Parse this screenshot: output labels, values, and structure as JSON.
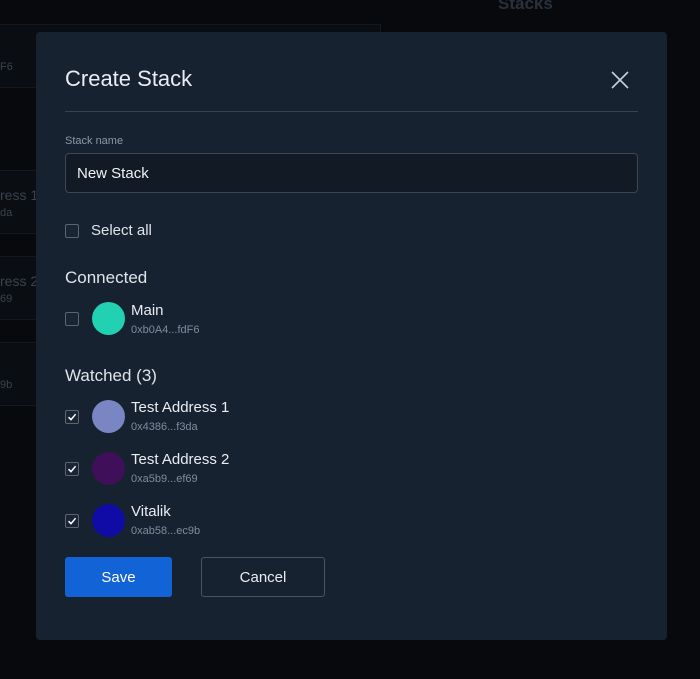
{
  "background": {
    "heading": "Stacks",
    "fragments": [
      "F6",
      "ress 1",
      "da",
      "ress 2",
      "69",
      "9b"
    ]
  },
  "modal": {
    "title": "Create Stack",
    "stack_name_label": "Stack name",
    "stack_name_value": "New Stack",
    "select_all_label": "Select all",
    "select_all_checked": false,
    "connected": {
      "title": "Connected",
      "accounts": [
        {
          "name": "Main",
          "address": "0xb0A4...fdF6",
          "avatar_color": "#21d1b2",
          "checked": false
        }
      ]
    },
    "watched": {
      "title": "Watched (3)",
      "accounts": [
        {
          "name": "Test Address 1",
          "address": "0x4386...f3da",
          "avatar_color": "#7a86c4",
          "checked": true
        },
        {
          "name": "Test Address 2",
          "address": "0xa5b9...ef69",
          "avatar_color": "#3f0f5a",
          "checked": true
        },
        {
          "name": "Vitalik",
          "address": "0xab58...ec9b",
          "avatar_color": "#100ba4",
          "checked": true
        }
      ]
    },
    "save_label": "Save",
    "cancel_label": "Cancel"
  },
  "colors": {
    "modal_bg": "#172230",
    "primary": "#1263d6"
  }
}
